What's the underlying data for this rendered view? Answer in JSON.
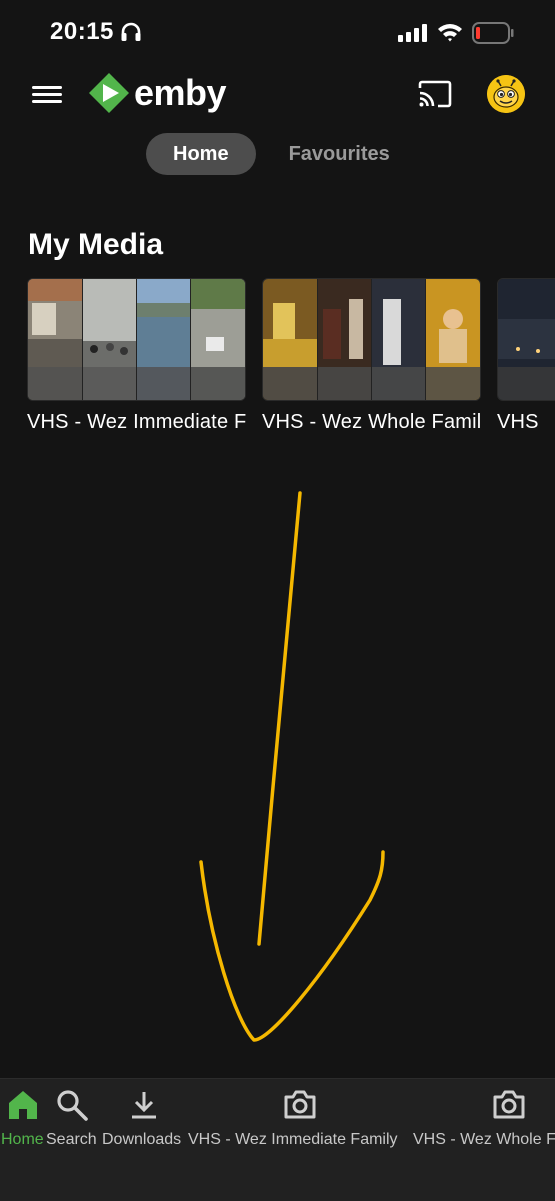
{
  "status_bar": {
    "time": "20:15"
  },
  "app": {
    "brand": "emby",
    "brand_color": "#52b54b",
    "accent_arrow_color": "#f5b800",
    "cast_icon": "cast-icon",
    "avatar_icon": "bee-avatar"
  },
  "tabs": [
    {
      "label": "Home",
      "active": true
    },
    {
      "label": "Favourites",
      "active": false
    }
  ],
  "section": {
    "title": "My Media"
  },
  "media": [
    {
      "title": "VHS - Wez Immediate Family"
    },
    {
      "title": "VHS - Wez Whole Family"
    },
    {
      "title": "VHS"
    }
  ],
  "bottom_nav": [
    {
      "label": "Home",
      "icon": "home-icon",
      "active": true
    },
    {
      "label": "Search",
      "icon": "search-icon"
    },
    {
      "label": "Downloads",
      "icon": "download-icon"
    },
    {
      "label": "VHS - Wez Immediate Family",
      "icon": "camera-icon"
    },
    {
      "label": "VHS - Wez Whole Family",
      "icon": "camera-icon"
    }
  ]
}
